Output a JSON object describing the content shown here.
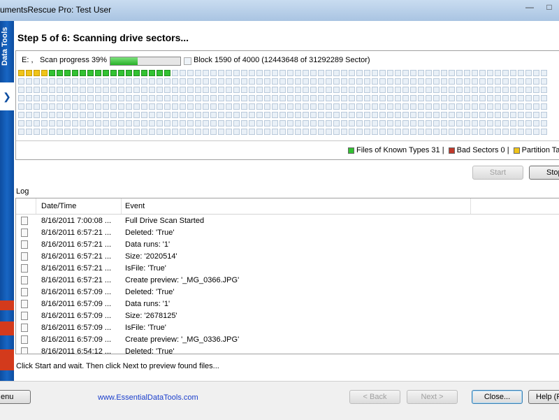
{
  "window": {
    "title": "umentsRescue Pro: Test User"
  },
  "sidebar": {
    "brand": "Data Tools"
  },
  "step_title": "Step 5 of 6: Scanning drive sectors...",
  "scan": {
    "drive": "E: ,",
    "progress_label": "Scan progress 39%",
    "progress_fraction": 0.39,
    "block_info": "Block 1590 of 4000 (12443648 of 31292289 Sector)",
    "grid": {
      "rows": 8,
      "cols": 69,
      "yellow_cells": 4,
      "green_cells": 16
    },
    "colors": {
      "known": "#32c232",
      "bad": "#c0392b",
      "partition": "#f0c419",
      "empty": "#e9f0f7"
    }
  },
  "legend": {
    "known": "Files of Known Types 31 |",
    "bad": "Bad Sectors 0 |",
    "partition": "Partition Ta"
  },
  "buttons": {
    "start": "Start",
    "stop": "Stop",
    "menu": "enu",
    "back": "< Back",
    "next": "Next >",
    "close": "Close...",
    "help": "Help (F"
  },
  "log": {
    "label": "Log",
    "columns": {
      "datetime": "Date/Time",
      "event": "Event"
    },
    "rows": [
      {
        "datetime": "8/16/2011 7:00:08 ...",
        "event": "Full Drive Scan Started"
      },
      {
        "datetime": "8/16/2011 6:57:21 ...",
        "event": "Deleted: 'True'"
      },
      {
        "datetime": "8/16/2011 6:57:21 ...",
        "event": "Data runs: '1'"
      },
      {
        "datetime": "8/16/2011 6:57:21 ...",
        "event": "Size: '2020514'"
      },
      {
        "datetime": "8/16/2011 6:57:21 ...",
        "event": "IsFile: 'True'"
      },
      {
        "datetime": "8/16/2011 6:57:21 ...",
        "event": "Create preview: '_MG_0366.JPG'"
      },
      {
        "datetime": "8/16/2011 6:57:09 ...",
        "event": "Deleted: 'True'"
      },
      {
        "datetime": "8/16/2011 6:57:09 ...",
        "event": "Data runs: '1'"
      },
      {
        "datetime": "8/16/2011 6:57:09 ...",
        "event": "Size: '2678125'"
      },
      {
        "datetime": "8/16/2011 6:57:09 ...",
        "event": "IsFile: 'True'"
      },
      {
        "datetime": "8/16/2011 6:57:09 ...",
        "event": "Create preview: '_MG_0336.JPG'"
      },
      {
        "datetime": "8/16/2011 6:54:12 ...",
        "event": "Deleted: 'True'"
      }
    ]
  },
  "hint": "Click Start and wait. Then click Next to preview found files...",
  "footer": {
    "link": "www.EssentialDataTools.com"
  }
}
